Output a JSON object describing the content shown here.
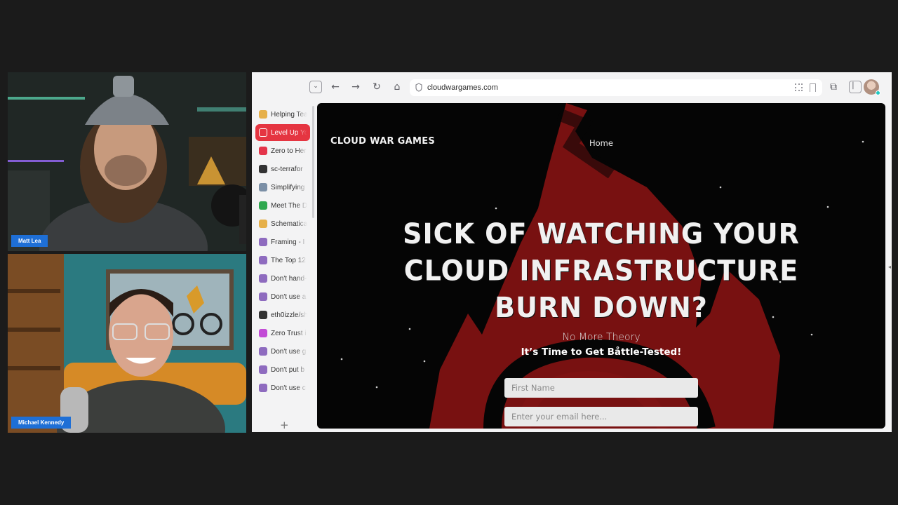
{
  "participants": [
    {
      "name": "Matt Lea"
    },
    {
      "name": "Michael Kennedy"
    }
  ],
  "browser": {
    "url": "cloudwargames.com",
    "tabs": [
      {
        "label": "Helping Tea",
        "favicon": "bulb-icon",
        "color": "#e6b04a",
        "active": false
      },
      {
        "label": "Level Up Yo",
        "favicon": "triangle-logo-icon",
        "color": "#ffffff",
        "active": true
      },
      {
        "label": "Zero to Her",
        "favicon": "ring-icon",
        "color": "#e4344a",
        "active": false
      },
      {
        "label": "sc-terrafor",
        "favicon": "github-icon",
        "color": "#333333",
        "active": false
      },
      {
        "label": "Simplifying",
        "favicon": "wave-icon",
        "color": "#7b8fa6",
        "active": false
      },
      {
        "label": "Meet The D",
        "favicon": "tc-icon",
        "color": "#2fa84f",
        "active": false
      },
      {
        "label": "Schematica",
        "favicon": "bulb-icon",
        "color": "#e6b04a",
        "active": false
      },
      {
        "label": "Framing - I",
        "favicon": "podcast-icon",
        "color": "#8e6bbf",
        "active": false
      },
      {
        "label": "The Top 12",
        "favicon": "podcast-icon",
        "color": "#8e6bbf",
        "active": false
      },
      {
        "label": "Don't hand-",
        "favicon": "podcast-icon",
        "color": "#8e6bbf",
        "active": false
      },
      {
        "label": "Don't use a",
        "favicon": "podcast-icon",
        "color": "#8e6bbf",
        "active": false
      },
      {
        "label": "eth0izzle/sh",
        "favicon": "github-icon",
        "color": "#333333",
        "active": false
      },
      {
        "label": "Zero Trust i",
        "favicon": "orb-icon",
        "color": "#c24bd6",
        "active": false
      },
      {
        "label": "Don't use g",
        "favicon": "podcast-icon",
        "color": "#8e6bbf",
        "active": false
      },
      {
        "label": "Don't put b",
        "favicon": "podcast-icon",
        "color": "#8e6bbf",
        "active": false
      },
      {
        "label": "Don't use c",
        "favicon": "podcast-icon",
        "color": "#8e6bbf",
        "active": false
      }
    ],
    "new_tab_label": "+"
  },
  "site": {
    "logo": "CLOUD WAR GAMES",
    "nav_home": "Home",
    "headline_lines": [
      "SICK OF WATCHING YOUR",
      "CLOUD INFRASTRUCTURE",
      "BURN DOWN?"
    ],
    "subheading": "No More Theory",
    "tagline": "It’s Time to Get Båttle-Tested!",
    "first_name_placeholder": "First Name",
    "email_placeholder": "Enter your email here...",
    "accent_color": "#8e1414"
  }
}
